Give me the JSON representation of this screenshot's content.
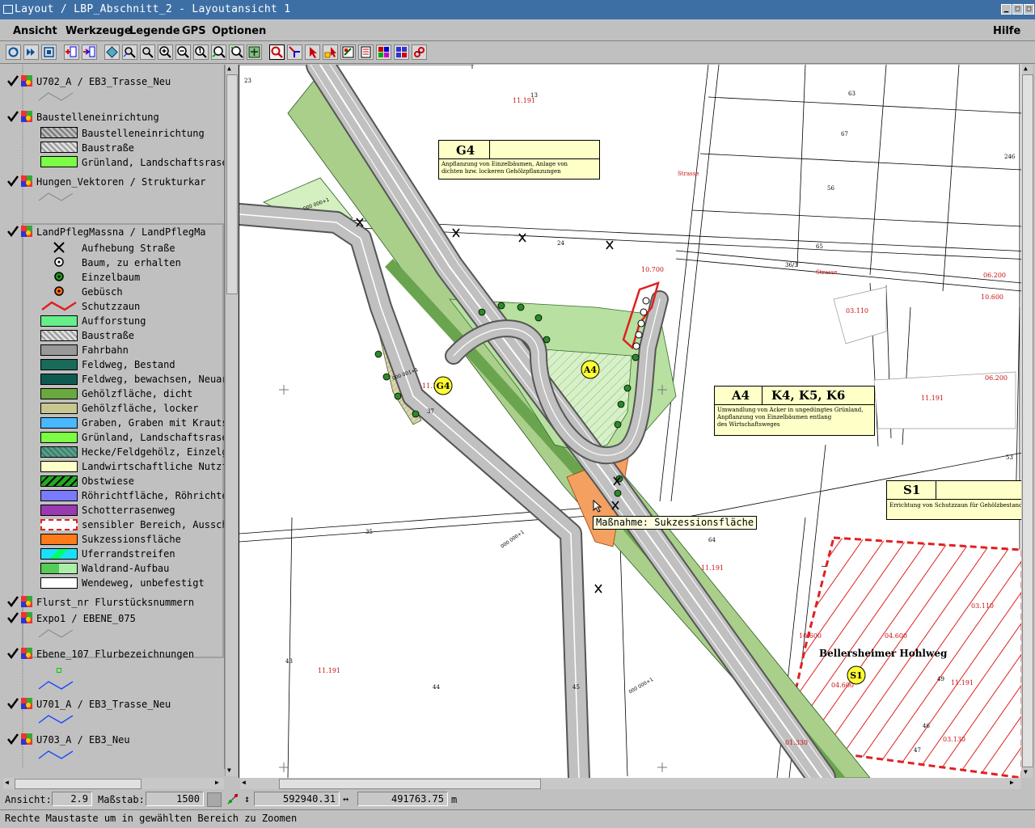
{
  "window": {
    "title": "Layout / LBP_Abschnitt_2 - Layoutansicht 1",
    "controls": [
      "minimize",
      "maximize",
      "close"
    ]
  },
  "menubar": {
    "items": [
      "Ansicht",
      "Werkzeuge",
      "Legende",
      "GPS",
      "Optionen"
    ],
    "help": "Hilfe"
  },
  "toolbar": {
    "buttons": [
      "refresh",
      "redraw-all",
      "full-extent",
      "add-layer",
      "remove-layer",
      "select-layer",
      "zoom-layer",
      "zoom-selection",
      "zoom-in",
      "zoom-out",
      "zoom-1",
      "zoom-previous",
      "zoom-next",
      "zoom-box",
      "pan",
      "select",
      "select-feature",
      "edit-feature",
      "attributes",
      "print",
      "layout",
      "tools",
      "settings"
    ]
  },
  "legend": {
    "layers": [
      {
        "title": "U702_A / EB3_Trasse_Neu",
        "checked": true
      },
      {
        "title": "Baustelleneinrichtung",
        "checked": true,
        "items": [
          "Baustelleneinrichtung",
          "Baustraße",
          "Grünland, Landschaftsrase"
        ]
      },
      {
        "title": "Hungen_Vektoren / Strukturkar",
        "checked": true
      },
      {
        "title": "LandPflegMassna / LandPflegMa",
        "checked": true,
        "items": [
          "Aufhebung Straße",
          "Baum, zu erhalten",
          "Einzelbaum",
          "Gebüsch",
          "Schutzzaun",
          "Aufforstung",
          "Baustraße",
          "Fahrbahn",
          "Feldweg, Bestand",
          "Feldweg, bewachsen, Neuar",
          "Gehölzfläche, dicht",
          "Gehölzfläche, locker",
          "Graben, Graben mit Krauts",
          "Grünland, Landschaftsrase",
          "Hecke/Feldgehölz, Einzelg",
          "Landwirtschaftliche Nutzf",
          "Obstwiese",
          "Röhrichtfläche, Röhrichte",
          "Schotterrasenweg",
          "sensibler Bereich, Aussch",
          "Sukzessionsfläche",
          "Uferrandstreifen",
          "Waldrand-Aufbau",
          "Wendeweg, unbefestigt"
        ]
      },
      {
        "title": "Flurst_nr Flurstücksnummern",
        "checked": true
      },
      {
        "title": "Expo1 / EBENE_075",
        "checked": true
      },
      {
        "title": "Ebene_107 Flurbezeichnungen",
        "checked": true
      },
      {
        "title": "U701_A / EB3_Trasse_Neu",
        "checked": true
      },
      {
        "title": "U703_A / EB3_Neu",
        "checked": true
      }
    ]
  },
  "map": {
    "boxes": [
      {
        "code": "G4",
        "codes2": "",
        "desc": [
          "Anpflanzung von Einzelbäumen, Anlage von",
          "dichten bzw. lockeren Gehölzpflanzungen"
        ]
      },
      {
        "code": "A4",
        "codes2": "K4, K5, K6",
        "desc": [
          "Umwandlung von Acker in ungedüngtes Grünland,",
          "Anpflanzung von Einzelbäumen entlang",
          "des Wirtschaftsweges"
        ]
      },
      {
        "code": "S1",
        "codes2": "",
        "desc": [
          "Errichtung von Schutzzaun für Gehölzbestand"
        ]
      }
    ],
    "markers": [
      "G4",
      "A4",
      "S1"
    ],
    "tooltip": "Maßnahme: Sukzessionsfläche",
    "street_name": "Bellersheimer Hohlweg",
    "labels_red": [
      "11.191",
      "10.700",
      "06.200",
      "10.600",
      "03.110",
      "06.200",
      "11.191",
      "11.191",
      "11.191",
      "04.600",
      "10.600",
      "04.600",
      "03.110",
      "11.191",
      "03.130",
      "01.330",
      "11.191",
      "11.191"
    ],
    "labels_black": [
      "23",
      "13",
      "63",
      "67",
      "246",
      "56",
      "24",
      "65",
      "36/3",
      "55",
      "64",
      "43",
      "44",
      "45",
      "53",
      "35",
      "37",
      "46",
      "47",
      "49"
    ],
    "strasse": [
      "Strasse",
      "Strasse"
    ],
    "chainage": [
      "000 000+1",
      "000 001+1",
      "000 000+1",
      "000 000+1"
    ]
  },
  "status": {
    "ansicht_label": "Ansicht:",
    "ansicht_value": "2.9",
    "massstab_label": "Maßstab:",
    "massstab_value": "1500",
    "x_value": "592940.31",
    "y_value": "491763.75",
    "unit": "m",
    "hint": "Rechte Maustaste um in gewählten Bereich zu Zoomen"
  }
}
